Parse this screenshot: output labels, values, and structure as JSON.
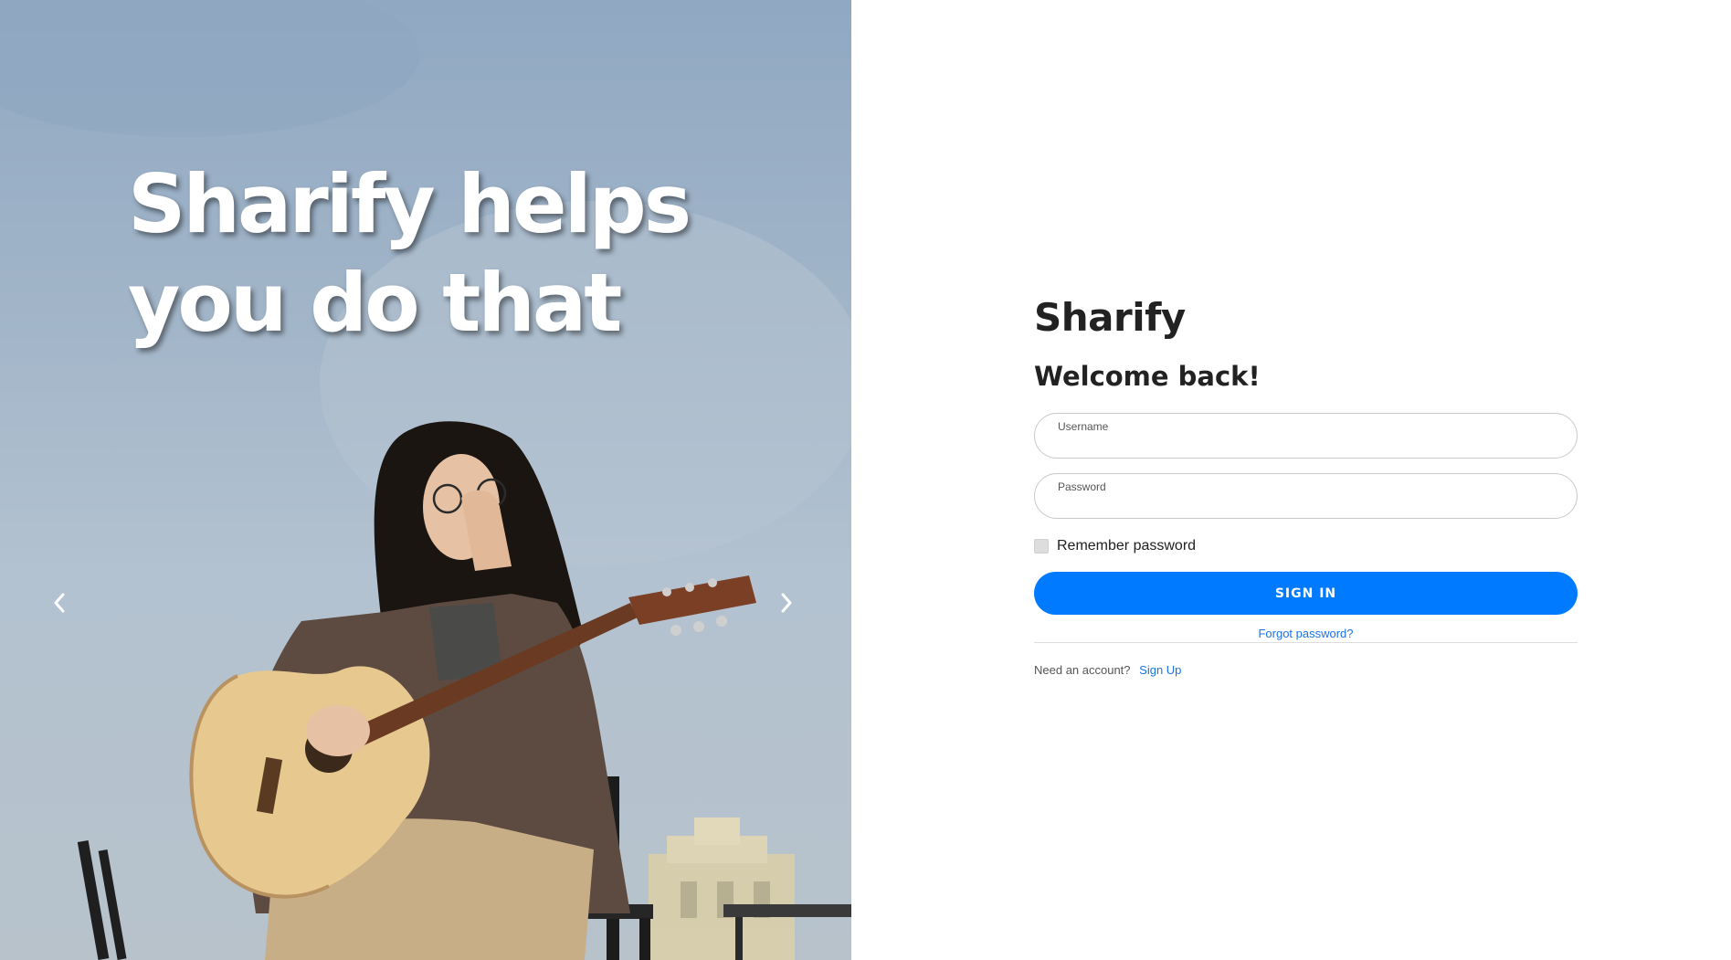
{
  "hero": {
    "caption": "Sharify helps you do that",
    "prev_arrow": "chevron-left-icon",
    "next_arrow": "chevron-right-icon"
  },
  "login": {
    "brand": "Sharify",
    "heading": "Welcome back!",
    "username_label": "Username",
    "username_value": "",
    "password_label": "Password",
    "password_value": "",
    "remember_label": "Remember password",
    "remember_checked": false,
    "signin_label": "SIGN IN",
    "forgot_label": "Forgot password?",
    "signup_prompt": "Need an account?",
    "signup_label": "Sign Up"
  },
  "colors": {
    "primary": "#007bff",
    "link": "#1a73e8",
    "heading": "#222222",
    "hero_sky": "#a3b6c9"
  }
}
